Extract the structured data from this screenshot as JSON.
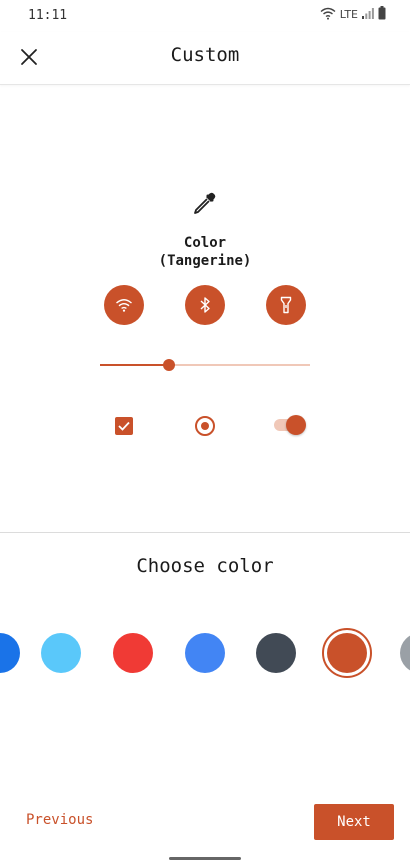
{
  "status": {
    "time": "11:11",
    "network": "LTE",
    "icons": [
      "wifi-icon",
      "signal-icon",
      "battery-icon"
    ]
  },
  "app_bar": {
    "title": "Custom",
    "close_icon": "close-icon"
  },
  "preview": {
    "icon": "eyedropper-icon",
    "color_label_line1": "Color",
    "color_label_line2": "(Tangerine)",
    "quick_settings": [
      "wifi-icon",
      "bluetooth-icon",
      "flashlight-icon"
    ],
    "slider_value": 0.33,
    "checkbox_checked": true,
    "radio_selected": true,
    "switch_on": true
  },
  "picker": {
    "title": "Choose color",
    "swatches": [
      {
        "name": "blue",
        "color": "#1a73e8"
      },
      {
        "name": "sky",
        "color": "#5ac8fa"
      },
      {
        "name": "red",
        "color": "#f03a35"
      },
      {
        "name": "cornflower",
        "color": "#4285f4"
      },
      {
        "name": "slate",
        "color": "#414a55"
      },
      {
        "name": "tangerine",
        "color": "#c9512a",
        "selected": true
      },
      {
        "name": "grey",
        "color": "#9aa0a6"
      }
    ]
  },
  "footer": {
    "previous_label": "Previous",
    "next_label": "Next"
  },
  "colors": {
    "accent": "#c9512a",
    "accent_light": "#f0c8b8",
    "text": "#1b1b1b",
    "divider": "#dcdcdc"
  }
}
